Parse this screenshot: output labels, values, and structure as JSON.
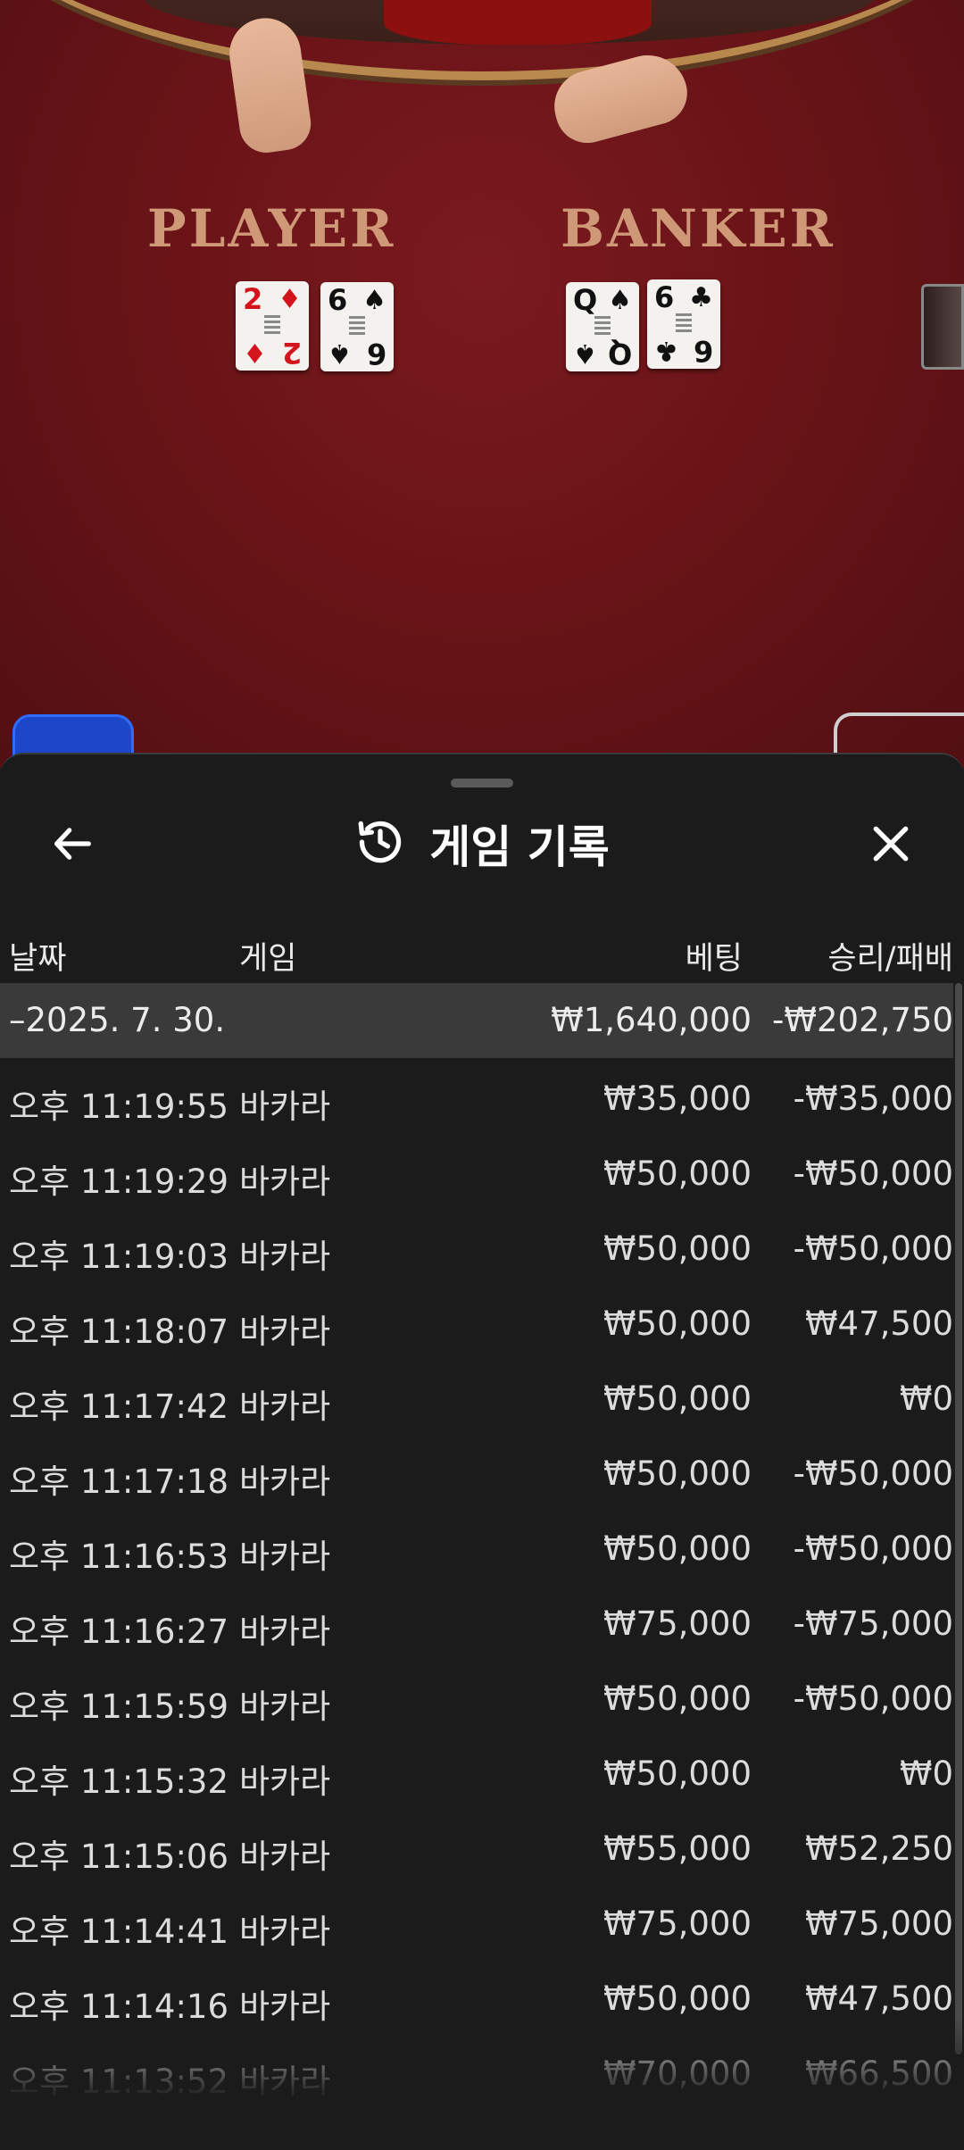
{
  "table": {
    "player_label": "PLAYER",
    "banker_label": "BANKER",
    "player_cards": [
      {
        "rank": "2",
        "suit": "♦",
        "color": "red"
      },
      {
        "rank": "6",
        "suit": "♠",
        "color": "black"
      }
    ],
    "banker_cards": [
      {
        "rank": "Q",
        "suit": "♠",
        "color": "black"
      },
      {
        "rank": "6",
        "suit": "♣",
        "color": "black"
      }
    ]
  },
  "sheet": {
    "title": "게임 기록",
    "back_icon": "arrow-left-icon",
    "history_icon": "history-clock-icon",
    "close_icon": "close-icon"
  },
  "columns": {
    "date": "날짜",
    "game": "게임",
    "bet": "베팅",
    "win_loss": "승리/패배"
  },
  "summary": {
    "date": "–2025. 7. 30.",
    "bet": "₩1,640,000",
    "win_loss": "-₩202,750"
  },
  "rows": [
    {
      "time": "오후 11:19:55",
      "game": "바카라",
      "bet": "₩35,000",
      "win_loss": "-₩35,000"
    },
    {
      "time": "오후 11:19:29",
      "game": "바카라",
      "bet": "₩50,000",
      "win_loss": "-₩50,000"
    },
    {
      "time": "오후 11:19:03",
      "game": "바카라",
      "bet": "₩50,000",
      "win_loss": "-₩50,000"
    },
    {
      "time": "오후 11:18:07",
      "game": "바카라",
      "bet": "₩50,000",
      "win_loss": "₩47,500"
    },
    {
      "time": "오후 11:17:42",
      "game": "바카라",
      "bet": "₩50,000",
      "win_loss": "₩0"
    },
    {
      "time": "오후 11:17:18",
      "game": "바카라",
      "bet": "₩50,000",
      "win_loss": "-₩50,000"
    },
    {
      "time": "오후 11:16:53",
      "game": "바카라",
      "bet": "₩50,000",
      "win_loss": "-₩50,000"
    },
    {
      "time": "오후 11:16:27",
      "game": "바카라",
      "bet": "₩75,000",
      "win_loss": "-₩75,000"
    },
    {
      "time": "오후 11:15:59",
      "game": "바카라",
      "bet": "₩50,000",
      "win_loss": "-₩50,000"
    },
    {
      "time": "오후 11:15:32",
      "game": "바카라",
      "bet": "₩50,000",
      "win_loss": "₩0"
    },
    {
      "time": "오후 11:15:06",
      "game": "바카라",
      "bet": "₩55,000",
      "win_loss": "₩52,250"
    },
    {
      "time": "오후 11:14:41",
      "game": "바카라",
      "bet": "₩75,000",
      "win_loss": "₩75,000"
    },
    {
      "time": "오후 11:14:16",
      "game": "바카라",
      "bet": "₩50,000",
      "win_loss": "₩47,500"
    },
    {
      "time": "오후 11:13:52",
      "game": "바카라",
      "bet": "₩70,000",
      "win_loss": "₩66,500"
    }
  ]
}
